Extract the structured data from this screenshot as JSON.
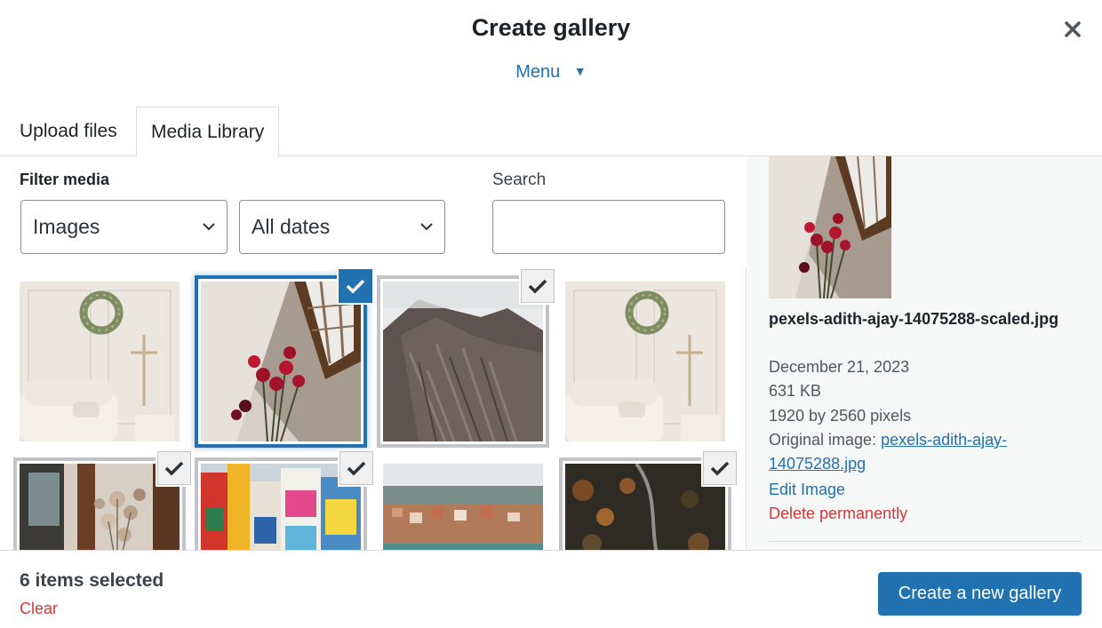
{
  "modal": {
    "title": "Create gallery",
    "menu_label": "Menu"
  },
  "tabs": [
    {
      "label": "Upload files"
    },
    {
      "label": "Media Library",
      "active": true
    }
  ],
  "filters": {
    "heading": "Filter media",
    "type_value": "Images",
    "date_value": "All dates",
    "search_label": "Search",
    "search_value": ""
  },
  "grid": {
    "items": [
      {
        "name": "living-room-wreath",
        "selected": false
      },
      {
        "name": "red-tulips-window",
        "selected": true,
        "focused": true
      },
      {
        "name": "mountain-ridge",
        "selected": true
      },
      {
        "name": "living-room-wreath-2",
        "selected": false
      },
      {
        "name": "dried-flowers",
        "selected": true
      },
      {
        "name": "colorful-street",
        "selected": true
      },
      {
        "name": "harbor-town",
        "selected": false
      },
      {
        "name": "autumn-forest-road",
        "selected": true
      }
    ]
  },
  "attachment": {
    "filename": "pexels-adith-ajay-14075288-scaled.jpg",
    "date": "December 21, 2023",
    "size": "631 KB",
    "dimensions": "1920 by 2560 pixels",
    "original_label": "Original image:",
    "original_link": "pexels-adith-ajay-14075288.jpg",
    "edit_label": "Edit Image",
    "delete_label": "Delete permanently"
  },
  "footer": {
    "count_label": "6 items selected",
    "clear_label": "Clear",
    "primary_label": "Create a new gallery"
  },
  "colors": {
    "accent": "#2271b1",
    "danger": "#d63638",
    "sidebar_bg": "#f6f7f7"
  },
  "icons": [
    "close-icon",
    "caret-down-icon",
    "chevron-down-icon",
    "checkmark-icon"
  ]
}
